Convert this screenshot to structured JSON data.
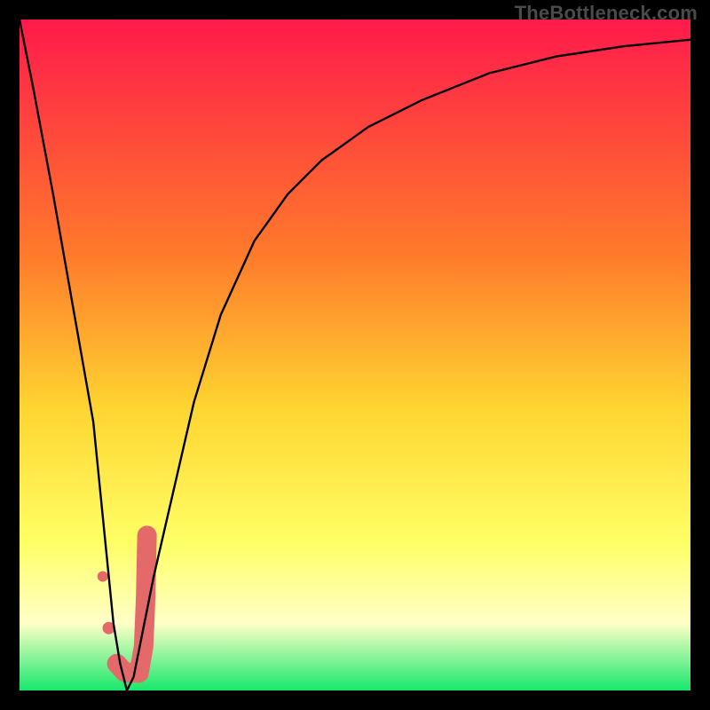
{
  "watermark": "TheBottleneck.com",
  "colors": {
    "frame": "#000000",
    "grad_top": "#ff1a4b",
    "grad_mid_upper": "#ff7a2b",
    "grad_mid": "#ffd531",
    "grad_mid_lower": "#ffff66",
    "grad_pale": "#ffffc8",
    "grad_bottom": "#17e86b",
    "curve": "#000000",
    "marker": "#e46a6a"
  },
  "chart_data": {
    "type": "line",
    "title": "",
    "xlabel": "",
    "ylabel": "",
    "ylim": [
      0,
      100
    ],
    "xlim": [
      0,
      100
    ],
    "x": [
      0,
      2,
      5,
      8,
      11,
      12,
      13,
      14,
      15,
      16,
      17,
      18,
      20,
      23,
      26,
      30,
      35,
      40,
      45,
      52,
      60,
      70,
      80,
      90,
      100
    ],
    "values": [
      100,
      90,
      74,
      57,
      40,
      30,
      20,
      10,
      4,
      0,
      2,
      7,
      17,
      30,
      43,
      56,
      67,
      74,
      79,
      84,
      88,
      92,
      94.5,
      96,
      97
    ],
    "hook_marker": {
      "center": {
        "x": 15.5,
        "y": 3
      },
      "points_relative_to_plot": [
        {
          "x": 12.4,
          "y": 17
        },
        {
          "x": 13.3,
          "y": 9.3
        },
        {
          "x": 14.5,
          "y": 4
        },
        {
          "x": 15.7,
          "y": 2.7
        },
        {
          "x": 17.8,
          "y": 2.6
        },
        {
          "x": 18.5,
          "y": 6.6
        },
        {
          "x": 18.8,
          "y": 13.9
        },
        {
          "x": 19.0,
          "y": 23.1
        }
      ]
    }
  }
}
